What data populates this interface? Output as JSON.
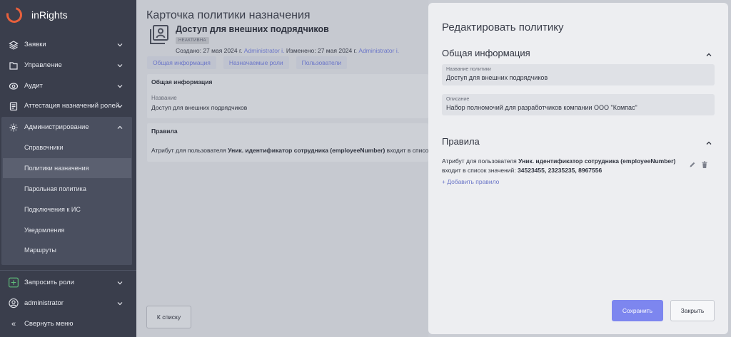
{
  "app": {
    "title": "inRights"
  },
  "sidebar": {
    "items": [
      {
        "label": "Заявки",
        "icon": "layers-icon"
      },
      {
        "label": "Управление",
        "icon": "folder-icon"
      },
      {
        "label": "Аудит",
        "icon": "eye-icon"
      },
      {
        "label": "Аттестация назначений ролей",
        "icon": "clipboard-icon"
      },
      {
        "label": "Администрирование",
        "icon": "gear-icon"
      }
    ],
    "admin_subitems": [
      {
        "label": "Справочники"
      },
      {
        "label": "Политики назначения"
      },
      {
        "label": "Парольная политика"
      },
      {
        "label": "Подключения к ИС"
      },
      {
        "label": "Уведомления"
      },
      {
        "label": "Маршруты"
      }
    ],
    "request_roles": "Запросить роли",
    "user": "administrator",
    "collapse": "Свернуть меню"
  },
  "page": {
    "title": "Карточка политики назначения",
    "policy_name": "Доступ для внешних подрядчиков",
    "status_badge": "НЕАКТИВНА",
    "created_label": "Создано:",
    "created_date": "27 мая 2024 г.",
    "created_by": "Administrator i.",
    "changed_label": "Изменено:",
    "changed_date": "27 мая 2024 г.",
    "changed_by": "Administrator i.",
    "tabs": [
      {
        "label": "Общая информация"
      },
      {
        "label": "Назначаемые роли"
      },
      {
        "label": "Пользователи"
      }
    ],
    "general_card": {
      "title": "Общая информация",
      "name_label": "Название",
      "name_value": "Доступ для внешних подрядчиков"
    },
    "rules_card": {
      "title": "Правила",
      "rule_prefix": "Атрибут для пользователя",
      "rule_attr": "Уник. идентификатор сотрудника (employeeNumber)",
      "rule_suffix": "входит в список"
    },
    "back_button": "К списку"
  },
  "drawer": {
    "title": "Редактировать политику",
    "general_section": "Общая информация",
    "name_field": {
      "label": "Название политики",
      "value": "Доступ для внешних подрядчиков"
    },
    "desc_field": {
      "label": "Описание",
      "value": "Набор полномочий для разработчиков компании ООО \"Компас\""
    },
    "rules_section": "Правила",
    "rule": {
      "prefix": "Атрибут для пользователя",
      "attr": "Уник. идентификатор сотрудника (employeeNumber)",
      "line2_prefix": "входит в список значений:",
      "values": "34523455, 23235235, 8967556"
    },
    "add_rule": "+ Добавить правило",
    "save_button": "Сохранить",
    "close_button": "Закрыть"
  },
  "colors": {
    "accent": "#7d86ef",
    "link": "#6b76c8",
    "sidebar_bg": "#3a3e4c",
    "logo": "#e8603c"
  }
}
